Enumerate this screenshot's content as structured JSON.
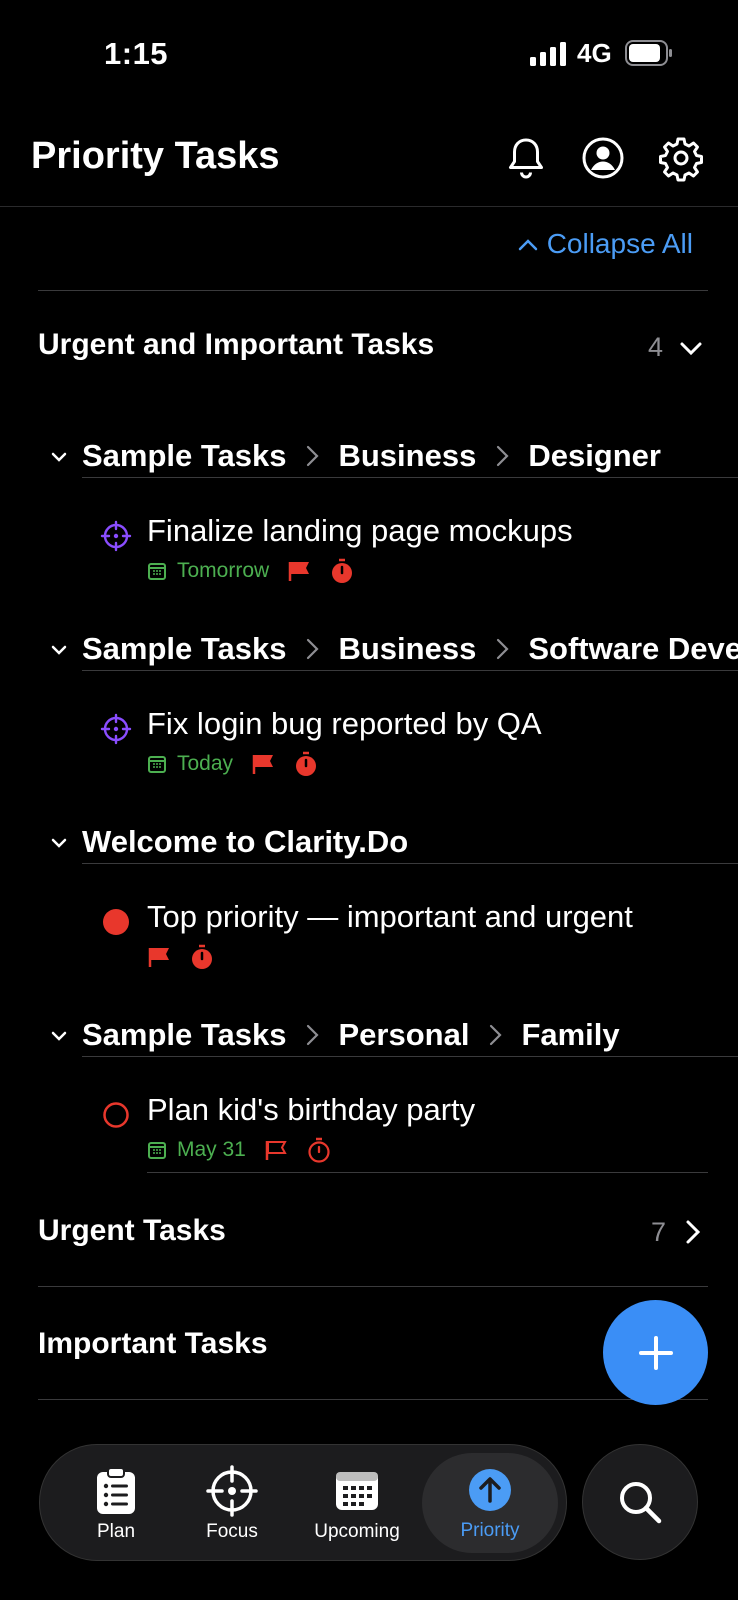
{
  "status_bar": {
    "time": "1:15",
    "network": "4G"
  },
  "header": {
    "title": "Priority Tasks"
  },
  "collapse_all_label": "Collapse All",
  "sections": [
    {
      "title": "Urgent and Important Tasks",
      "count": "4",
      "expanded": true,
      "groups": [
        {
          "breadcrumb": [
            "Sample Tasks",
            "Business",
            "Designer"
          ],
          "tasks": [
            {
              "title": "Finalize landing page mockups",
              "due": "Tomorrow",
              "icon": "focus-target-icon"
            }
          ]
        },
        {
          "breadcrumb": [
            "Sample Tasks",
            "Business",
            "Software Deve"
          ],
          "tasks": [
            {
              "title": "Fix login bug reported by QA",
              "due": "Today",
              "icon": "focus-target-icon"
            }
          ]
        },
        {
          "breadcrumb": [
            "Welcome to Clarity.Do"
          ],
          "tasks": [
            {
              "title": "Top priority — important and urgent",
              "due": "",
              "icon": "filled-circle-icon"
            }
          ]
        },
        {
          "breadcrumb": [
            "Sample Tasks",
            "Personal",
            "Family"
          ],
          "tasks": [
            {
              "title": "Plan kid's birthday party",
              "due": "May 31",
              "icon": "empty-circle-icon"
            }
          ]
        }
      ]
    },
    {
      "title": "Urgent Tasks",
      "count": "7",
      "expanded": false
    },
    {
      "title": "Important Tasks",
      "count": "",
      "expanded": false
    }
  ],
  "tabs": [
    {
      "label": "Plan",
      "icon": "clipboard-list-icon",
      "active": false
    },
    {
      "label": "Focus",
      "icon": "crosshair-icon",
      "active": false
    },
    {
      "label": "Upcoming",
      "icon": "calendar-icon",
      "active": false
    },
    {
      "label": "Priority",
      "icon": "arrow-up-circle-icon",
      "active": true
    }
  ],
  "colors": {
    "accent": "#4b9cf5",
    "fab": "#3a8ef6",
    "date_green": "#4caf50",
    "priority_red": "#e8372c",
    "focus_purple": "#8a4dff"
  }
}
